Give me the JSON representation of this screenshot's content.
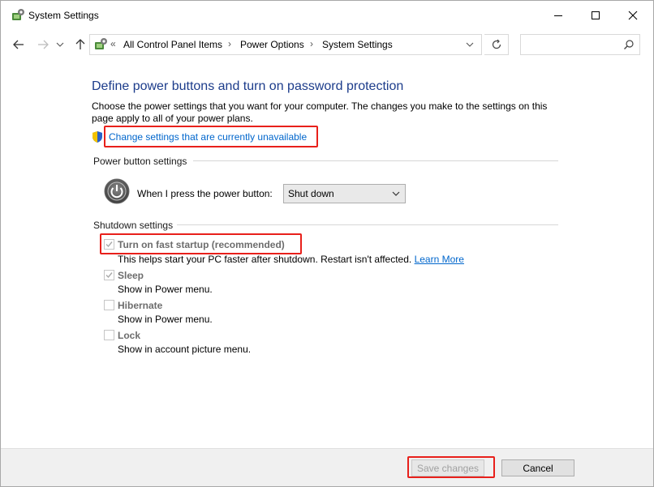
{
  "window": {
    "title": "System Settings"
  },
  "address_bar": {
    "prefix": "«",
    "breadcrumbs": [
      "All Control Panel Items",
      "Power Options",
      "System Settings"
    ],
    "separator": "›",
    "search_placeholder": ""
  },
  "main": {
    "heading": "Define power buttons and turn on password protection",
    "description": "Choose the power settings that you want for your computer. The changes you make to the settings on this page apply to all of your power plans.",
    "change_link": "Change settings that are currently unavailable"
  },
  "power_button_section": {
    "title": "Power button settings",
    "label": "When I press the power button:",
    "selected": "Shut down"
  },
  "shutdown_section": {
    "title": "Shutdown settings",
    "options": [
      {
        "label": "Turn on fast startup (recommended)",
        "desc": "This helps start your PC faster after shutdown. Restart isn't affected.",
        "link": "Learn More",
        "checked": true
      },
      {
        "label": "Sleep",
        "desc": "Show in Power menu.",
        "checked": true
      },
      {
        "label": "Hibernate",
        "desc": "Show in Power menu.",
        "checked": false
      },
      {
        "label": "Lock",
        "desc": "Show in account picture menu.",
        "checked": false
      }
    ]
  },
  "footer": {
    "save_label": "Save changes",
    "cancel_label": "Cancel"
  },
  "colors": {
    "heading": "#1c3c8b",
    "link": "#0066cc",
    "highlight": "#e8201b"
  }
}
